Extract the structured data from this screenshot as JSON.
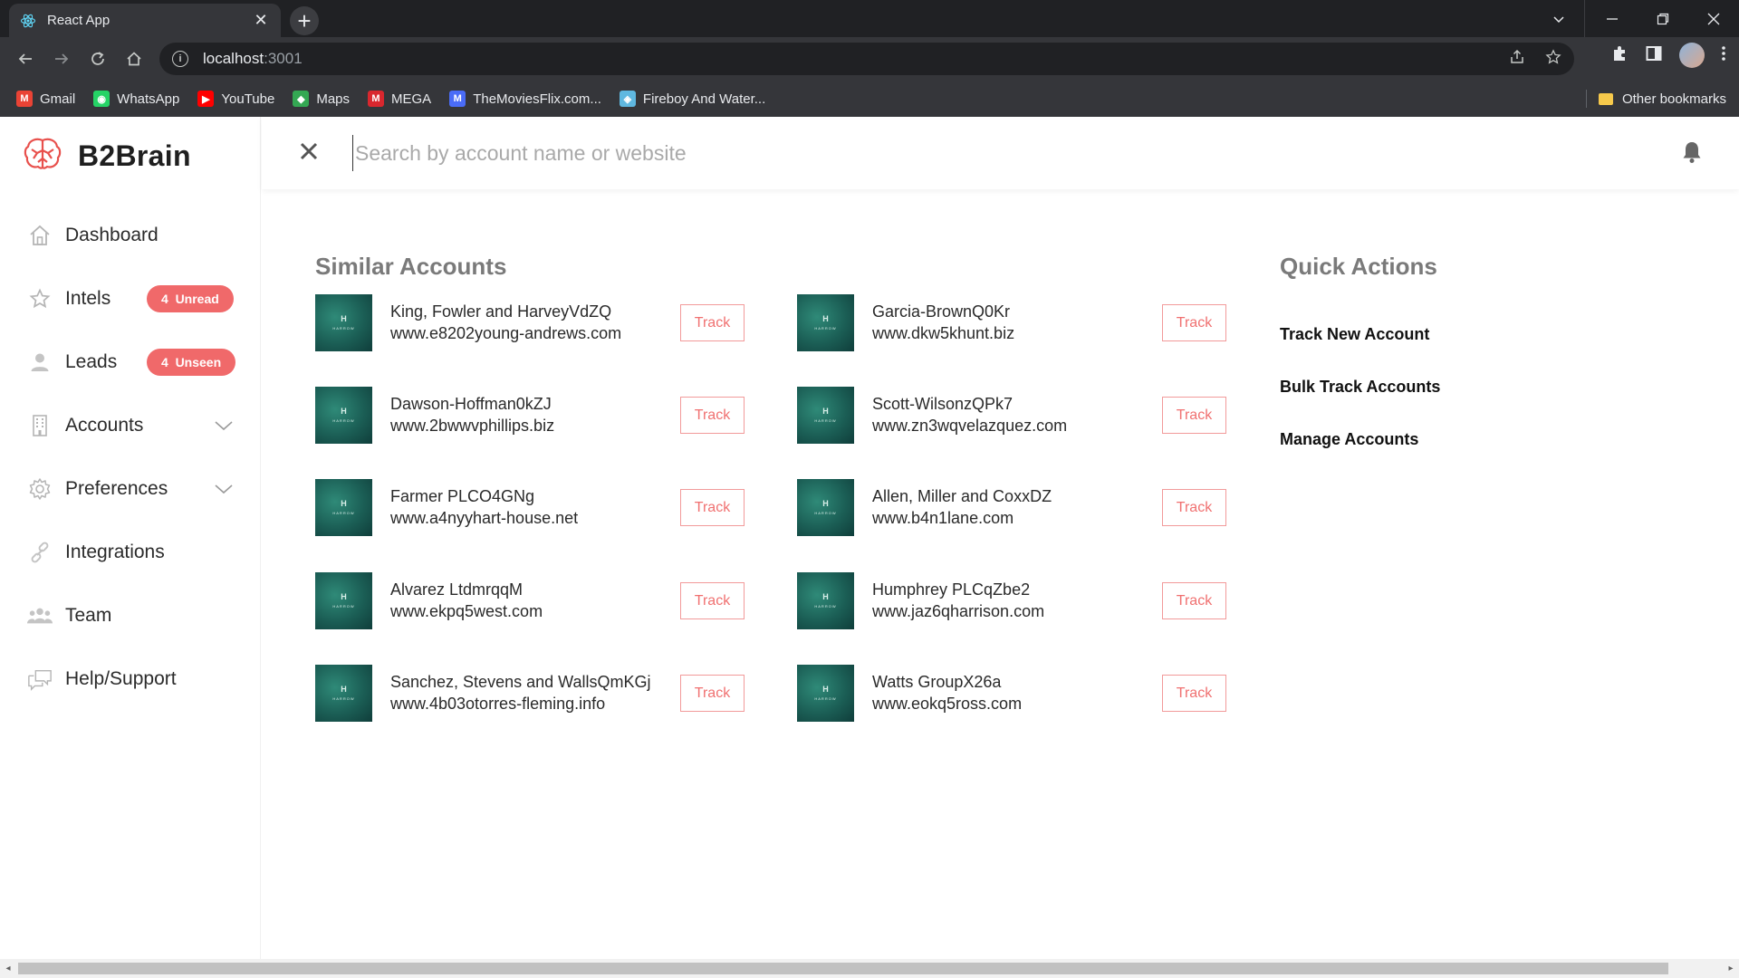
{
  "browser": {
    "tab_title": "React App",
    "url_host": "localhost",
    "url_port": ":3001",
    "bookmarks": [
      {
        "label": "Gmail",
        "icon": "gmail-icon",
        "color": "#ea4335"
      },
      {
        "label": "WhatsApp",
        "icon": "whatsapp-icon",
        "color": "#25d366"
      },
      {
        "label": "YouTube",
        "icon": "youtube-icon",
        "color": "#ff0000"
      },
      {
        "label": "Maps",
        "icon": "maps-icon",
        "color": "#34a853"
      },
      {
        "label": "MEGA",
        "icon": "mega-icon",
        "color": "#d9272e"
      },
      {
        "label": "TheMoviesFlix.com...",
        "icon": "moviesflix-icon",
        "color": "#4a6cf7"
      },
      {
        "label": "Fireboy And Water...",
        "icon": "fireboy-icon",
        "color": "#5fb8e0"
      }
    ],
    "other_bookmarks": "Other bookmarks"
  },
  "app": {
    "brand": "B2Brain",
    "brand_color": "#e8504c",
    "search": {
      "placeholder": "Search by account name or website",
      "value": ""
    },
    "nav": [
      {
        "label": "Dashboard",
        "icon": "home-icon"
      },
      {
        "label": "Intels",
        "icon": "star-icon",
        "badge": "4  Unread"
      },
      {
        "label": "Leads",
        "icon": "user-icon",
        "badge": "4  Unseen"
      },
      {
        "label": "Accounts",
        "icon": "building-icon",
        "expandable": true
      },
      {
        "label": "Preferences",
        "icon": "gear-icon",
        "expandable": true
      },
      {
        "label": "Integrations",
        "icon": "link-icon"
      },
      {
        "label": "Team",
        "icon": "team-icon"
      },
      {
        "label": "Help/Support",
        "icon": "chat-icon"
      }
    ],
    "similar_title": "Similar Accounts",
    "track_label": "Track",
    "thumb_text": {
      "letter": "H",
      "word": "HARROW"
    },
    "accounts": [
      {
        "name": "King, Fowler and HarveyVdZQ",
        "url": "www.e8202young-andrews.com"
      },
      {
        "name": "Garcia-BrownQ0Kr",
        "url": "www.dkw5khunt.biz"
      },
      {
        "name": "Dawson-Hoffman0kZJ",
        "url": "www.2bwwvphillips.biz"
      },
      {
        "name": "Scott-WilsonzQPk7",
        "url": "www.zn3wqvelazquez.com"
      },
      {
        "name": "Farmer PLCO4GNg",
        "url": "www.a4nyyhart-house.net"
      },
      {
        "name": "Allen, Miller and CoxxDZ",
        "url": "www.b4n1lane.com"
      },
      {
        "name": "Alvarez LtdmrqqM",
        "url": "www.ekpq5west.com"
      },
      {
        "name": "Humphrey PLCqZbe2",
        "url": "www.jaz6qharrison.com"
      },
      {
        "name": "Sanchez, Stevens and WallsQmKGj",
        "url": "www.4b03otorres-fleming.info"
      },
      {
        "name": "Watts GroupX26a",
        "url": "www.eokq5ross.com"
      }
    ],
    "quick_title": "Quick Actions",
    "quick_actions": [
      "Track New Account",
      "Bulk Track Accounts",
      "Manage Accounts"
    ]
  }
}
